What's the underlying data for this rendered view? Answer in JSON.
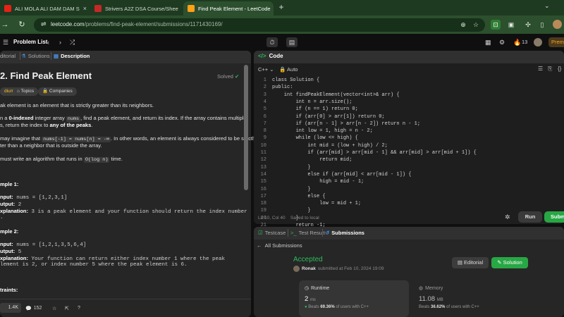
{
  "browser": {
    "tabs": [
      {
        "title": "ALI MOLA ALI DAM DAM S",
        "favicon_color": "#e62117"
      },
      {
        "title": "Strivers A2Z DSA Course/Shee",
        "favicon_color": "#c62828"
      },
      {
        "title": "Find Peak Element - LeetCode",
        "favicon_color": "#ffa116",
        "active": true
      }
    ],
    "url_host": "leetcode.com",
    "url_path": "/problems/find-peak-element/submissions/1171430169/"
  },
  "header": {
    "problem_list": "Problem List",
    "streak": "13",
    "premium": "Premi"
  },
  "left": {
    "tabs": [
      "Editorial",
      "Solutions",
      "Description"
    ],
    "tabs_visible": [
      "ditorial",
      "Solutions",
      "Description"
    ],
    "title": "2. Find Peak Element",
    "status": "Solved",
    "difficulty": "dium",
    "topics": "Topics",
    "companies": "Companies",
    "p1": "ak element is an element that is strictly greater than its neighbors.",
    "p2a": "n a ",
    "p2b": "0-indexed",
    "p2c": " integer array ",
    "p2d": "nums",
    "p2e": ", find a peak element, and return its index. If the array contains multiple",
    "p3a": "s, return the index to ",
    "p3b": "any of the peaks",
    "p3c": ".",
    "p4a": "may imagine that ",
    "p4b": "nums[-1] = nums[n] = -∞",
    "p4c": ". In other words, an element is always considered to be strictly",
    "p5": "ter than a neighbor that is outside the array.",
    "p6a": "must write an algorithm that runs in ",
    "p6b": "O(log n)",
    "p6c": " time.",
    "ex1_title": "mple 1:",
    "ex1_input_label": "nput:",
    "ex1_input": " nums = [1,2,3,1]",
    "ex1_output_label": "utput:",
    "ex1_output": " 2",
    "ex1_expl_label": "xplanation:",
    "ex1_expl": " 3 is a peak element and your function should return the index number",
    "ex1_expl2": ".",
    "ex2_title": "mple 2:",
    "ex2_input_label": "nput:",
    "ex2_input": " nums = [1,2,1,3,5,6,4]",
    "ex2_output_label": "utput:",
    "ex2_output": " 5",
    "ex2_expl_label": "xplanation:",
    "ex2_expl": " Your function can return either index number 1 where the peak",
    "ex2_expl2": "lement is 2, or index number 5 where the peak element is 6.",
    "constraints": "traints:",
    "likes": "1.4K",
    "comments": "152"
  },
  "editor": {
    "title": "Code",
    "language": "C++",
    "mode": "Auto",
    "lines": [
      "class Solution {",
      "public:",
      "    int findPeakElement(vector<int>& arr) {",
      "        int n = arr.size();",
      "        if (n == 1) return 0;",
      "        if (arr[0] > arr[1]) return 0;",
      "        if (arr[n - 1] > arr[n - 2]) return n - 1;",
      "        int low = 1, high = n - 2;",
      "        while (low <= high) {",
      "            int mid = (low + high) / 2;",
      "            if (arr[mid] > arr[mid - 1] && arr[mid] > arr[mid + 1]) {",
      "                return mid;",
      "            }",
      "            else if (arr[mid] < arr[mid - 1]) {",
      "                high = mid - 1;",
      "            }",
      "            else {",
      "                low = mid + 1;",
      "            }",
      "        }",
      "        return -1;"
    ],
    "cursor": "Ln 10, Col 40",
    "saved": "Saved to local",
    "run": "Run",
    "submit": "Subm"
  },
  "result": {
    "tabs": [
      "Testcase",
      "Test Result",
      "Submissions"
    ],
    "back": "All Submissions",
    "verdict": "Accepted",
    "user": "Ronak",
    "submitted": "submitted at Feb 10, 2024 19:09",
    "editorial_btn": "Editorial",
    "solution_btn": "Solution",
    "runtime_label": "Runtime",
    "runtime_value": "2",
    "runtime_unit": "ms",
    "runtime_beats_pre": "Beats ",
    "runtime_beats": "69.36%",
    "runtime_beats_post": " of users with C++",
    "memory_label": "Memory",
    "memory_value": "11.08",
    "memory_unit": "MB",
    "memory_beats_pre": "Beats ",
    "memory_beats": "36.62%",
    "memory_beats_post": " of users with C++"
  }
}
